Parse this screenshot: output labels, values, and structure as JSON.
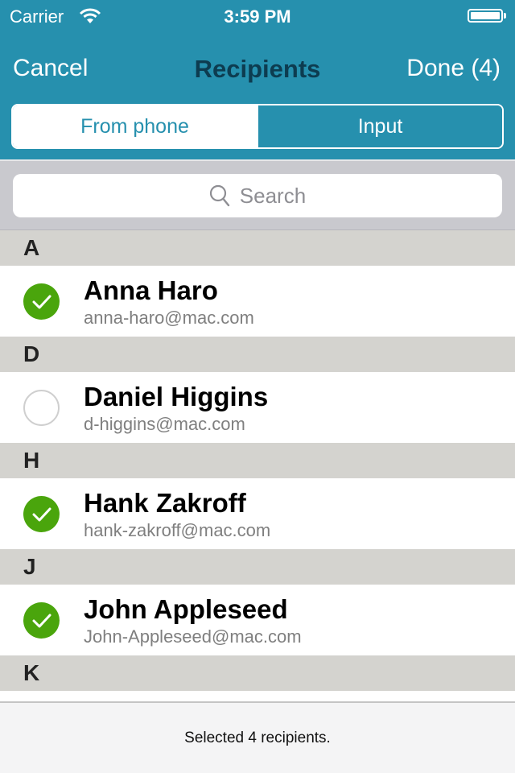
{
  "status_bar": {
    "carrier": "Carrier",
    "time": "3:59 PM",
    "wifi_icon": "wifi-icon",
    "battery_icon": "battery-icon",
    "battery_level": 1.0
  },
  "nav": {
    "cancel_label": "Cancel",
    "title": "Recipients",
    "done_label": "Done (4)"
  },
  "segmented": {
    "options": [
      {
        "label": "From phone",
        "selected": true
      },
      {
        "label": "Input",
        "selected": false
      }
    ]
  },
  "search": {
    "placeholder": "Search",
    "icon": "search-icon"
  },
  "sections": [
    {
      "letter": "A",
      "contacts": [
        {
          "name": "Anna Haro",
          "email": "anna-haro@mac.com",
          "selected": true
        }
      ]
    },
    {
      "letter": "D",
      "contacts": [
        {
          "name": "Daniel Higgins",
          "email": "d-higgins@mac.com",
          "selected": false
        }
      ]
    },
    {
      "letter": "H",
      "contacts": [
        {
          "name": "Hank Zakroff",
          "email": "hank-zakroff@mac.com",
          "selected": true
        }
      ]
    },
    {
      "letter": "J",
      "contacts": [
        {
          "name": "John Appleseed",
          "email": "John-Appleseed@mac.com",
          "selected": true
        }
      ]
    },
    {
      "letter": "K",
      "contacts": []
    }
  ],
  "footer": {
    "status_text": "Selected 4 recipients."
  },
  "colors": {
    "brand": "#2690ae",
    "title": "#0d3c50",
    "check_on": "#4aa50c",
    "section_bg": "#d4d3cf"
  }
}
